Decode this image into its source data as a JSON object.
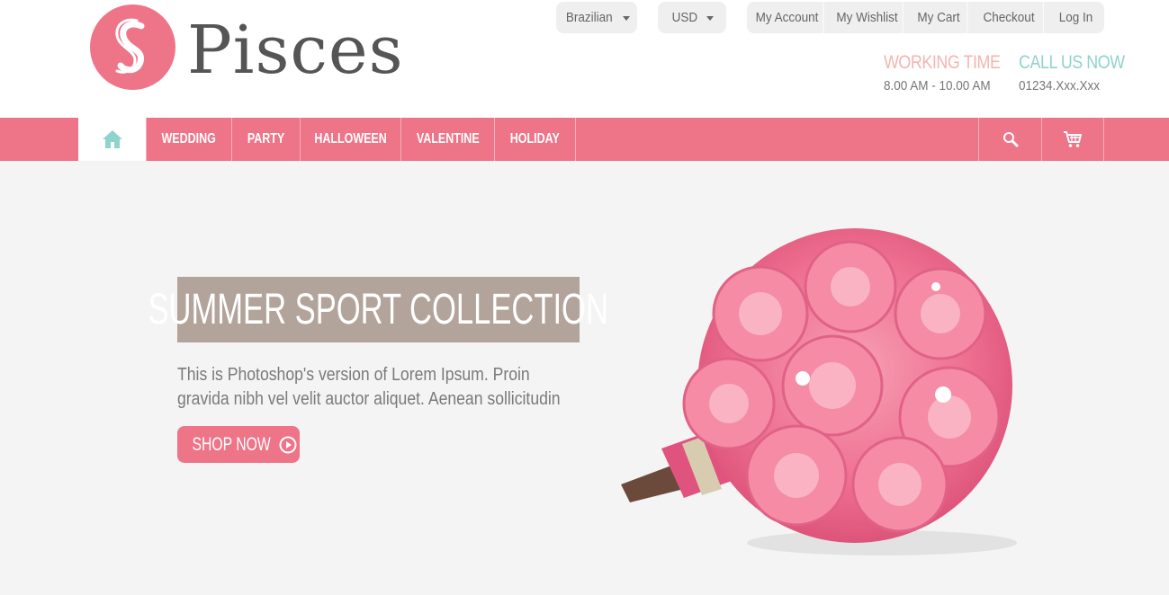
{
  "brand": {
    "name": "Pisces",
    "logo_letter": "S"
  },
  "topbar": {
    "language": "Brazilian",
    "currency": "USD",
    "account_links": [
      "My Account",
      "My Wishlist",
      "My Cart",
      "Checkout",
      "Log In"
    ]
  },
  "contact": {
    "working_time_label": "WORKING TIME",
    "working_time_value": "8.00 AM - 10.00 AM",
    "call_label": "CALL US NOW",
    "call_value": "01234.Xxx.Xxx"
  },
  "nav": {
    "items": [
      "WEDDING",
      "PARTY",
      "HALLOWEEN",
      "VALENTINE",
      "HOLIDAY"
    ]
  },
  "hero": {
    "title": "SUMMER SPORT COLLECTION",
    "description": "This is Photoshop's version of Lorem Ipsum. Proin gravida nibh vel velit auctor aliquet. Aenean sollicitudin",
    "button_label": "SHOP NOW"
  },
  "colors": {
    "accent_pink": "#ee7488",
    "teal": "#8fd3cc",
    "peach": "#f3b5b0",
    "title_box": "#b2a49b"
  }
}
